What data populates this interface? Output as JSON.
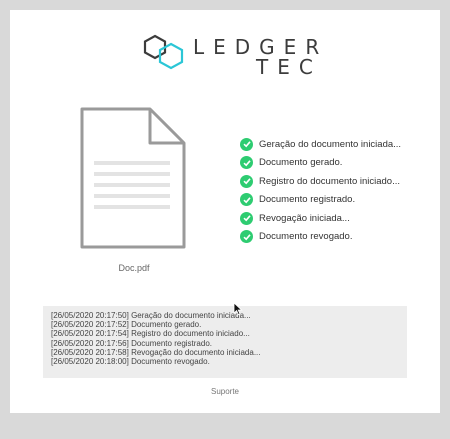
{
  "logo": {
    "line1": "LEDGER",
    "line2": "TEC",
    "accent_color": "#2bc6d6",
    "dark_color": "#3c3c3c"
  },
  "document": {
    "icon": "file-icon",
    "name": "Doc.pdf"
  },
  "steps": [
    {
      "label": "Geração do documento iniciada...",
      "icon": "check-circle-icon"
    },
    {
      "label": "Documento gerado.",
      "icon": "check-circle-icon"
    },
    {
      "label": "Registro do documento iniciado...",
      "icon": "check-circle-icon"
    },
    {
      "label": "Documento registrado.",
      "icon": "check-circle-icon"
    },
    {
      "label": "Revogação iniciada...",
      "icon": "check-circle-icon"
    },
    {
      "label": "Documento revogado.",
      "icon": "check-circle-icon"
    }
  ],
  "status_color": "#2ecc71",
  "log": [
    "[26/05/2020 20:17:50] Geração do documento iniciada...",
    "[26/05/2020 20:17:52] Documento gerado.",
    "[26/05/2020 20:17:54] Registro do documento iniciado...",
    "[26/05/2020 20:17:56] Documento registrado.",
    "[26/05/2020 20:17:58] Revogação do documento iniciada...",
    "[26/05/2020 20:18:00] Documento revogado."
  ],
  "footer": {
    "support_label": "Suporte"
  }
}
